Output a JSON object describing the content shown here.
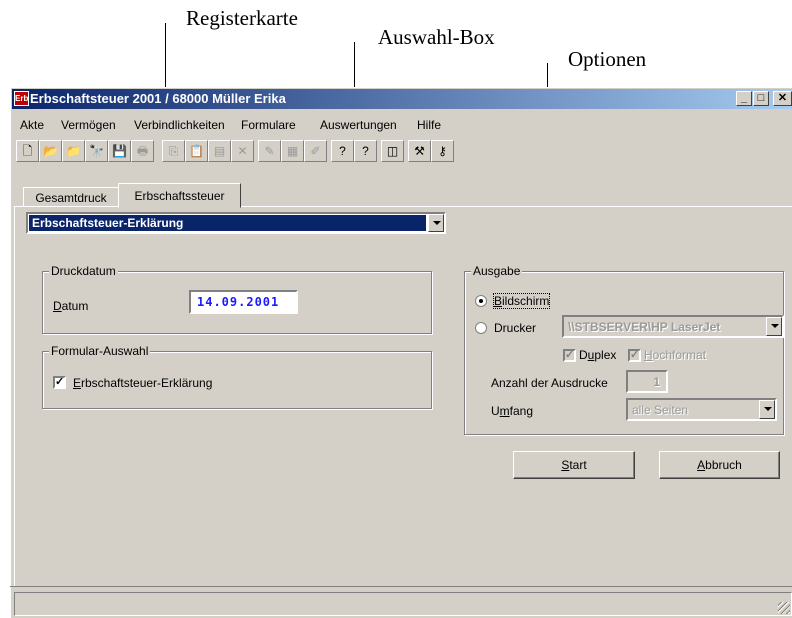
{
  "callouts": {
    "tab": "Registerkarte",
    "combo": "Auswahl-Box",
    "options": "Optionen"
  },
  "window": {
    "title": "Erbschaftsteuer 2001 / 68000 Müller Erika",
    "icon_text": "Erb"
  },
  "menu": [
    "Akte",
    "Vermögen",
    "Verbindlichkeiten",
    "Formulare",
    "Auswertungen",
    "Hilfe"
  ],
  "toolbar": [
    {
      "name": "new-document-icon",
      "glyph": "🗋"
    },
    {
      "name": "open-folder-icon",
      "glyph": "📂"
    },
    {
      "name": "folder-icon",
      "glyph": "📁"
    },
    {
      "name": "search-binoculars-icon",
      "glyph": "🔭"
    },
    {
      "name": "save-icon",
      "glyph": "💾"
    },
    {
      "name": "print-icon",
      "glyph": "🖶"
    },
    {
      "name": "copy-icon",
      "glyph": "⎘"
    },
    {
      "name": "paste-icon",
      "glyph": "📋"
    },
    {
      "name": "form-icon",
      "glyph": "▤"
    },
    {
      "name": "delete-icon",
      "glyph": "✕"
    },
    {
      "name": "stamp-icon",
      "glyph": "✎"
    },
    {
      "name": "document-list-icon",
      "glyph": "▦"
    },
    {
      "name": "edit-document-icon",
      "glyph": "✐"
    },
    {
      "name": "context-help-icon",
      "glyph": "?"
    },
    {
      "name": "help-icon",
      "glyph": "?"
    },
    {
      "name": "window-icon",
      "glyph": "◫"
    },
    {
      "name": "tools-icon",
      "glyph": "⚒"
    },
    {
      "name": "key-icon",
      "glyph": "⚷"
    }
  ],
  "tabs": [
    "Gesamtdruck",
    "Erbschaftssteuer"
  ],
  "form_select": {
    "value": "Erbschaftsteuer-Erklärung"
  },
  "druckdatum": {
    "legend": "Druckdatum",
    "label_u": "D",
    "label_rest": "atum",
    "value": "14.09.2001"
  },
  "formular_auswahl": {
    "legend": "Formular-Auswahl",
    "item_u": "E",
    "item_rest": "rbschaftsteuer-Erklärung",
    "checked": true
  },
  "ausgabe": {
    "legend": "Ausgabe",
    "bildschirm_u": "B",
    "bildschirm_rest": "ildschirm",
    "drucker": "Drucker",
    "printer_value": "\\\\STBSERVER\\HP LaserJet",
    "duplex_pre": "D",
    "duplex_u": "u",
    "duplex_rest": "plex",
    "hochformat_u": "H",
    "hochformat_rest": "ochformat",
    "anzahl_pre": "Anzahl der Ausdrucke",
    "anzahl_value": "1",
    "umfang_pre": "U",
    "umfang_u": "m",
    "umfang_rest": "fang",
    "umfang_value": "alle Seiten"
  },
  "buttons": {
    "start_u": "S",
    "start_rest": "tart",
    "abbruch_u": "A",
    "abbruch_rest": "bbruch"
  }
}
